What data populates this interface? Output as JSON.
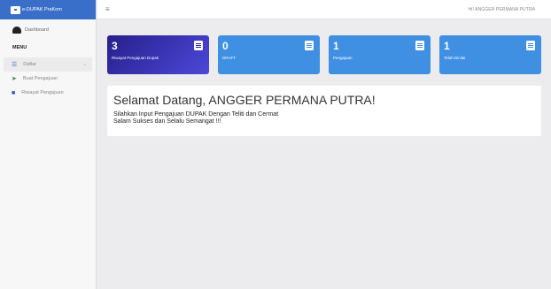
{
  "brand": {
    "name": "e-DUPAK PraKom",
    "icon": "briefcase-icon"
  },
  "sidebar": {
    "dashboard": "Dashboard",
    "menu_heading": "MENU",
    "group": {
      "label": "Daftar",
      "icon": "list-icon"
    },
    "items": [
      {
        "label": "Buat Pengajuan",
        "icon": "send-icon"
      },
      {
        "label": "Riwayat Pengajuan",
        "icon": "folder-icon"
      }
    ]
  },
  "header": {
    "menu_icon": "≡",
    "greeting": "Hi! ANGGER PERMANA PUTRA"
  },
  "cards": [
    {
      "count": "3",
      "caption": "Riwayat Pengajuan Dupak",
      "color": "#2b2496"
    },
    {
      "count": "0",
      "caption": "DRAFT",
      "color": "#3f8fe3"
    },
    {
      "count": "1",
      "caption": "Pengajuan",
      "color": "#3f8fe3"
    },
    {
      "count": "1",
      "caption": "Telah Dinilai",
      "color": "#3f8fe3"
    }
  ],
  "welcome": {
    "title": "Selamat Datang, ANGGER PERMANA PUTRA!",
    "line1": "Silahkan Input Pengajuan DUPAK Dengan Teliti dan Cermat",
    "line2": "Salam Sukses dan Selalu Semangat !!!"
  }
}
